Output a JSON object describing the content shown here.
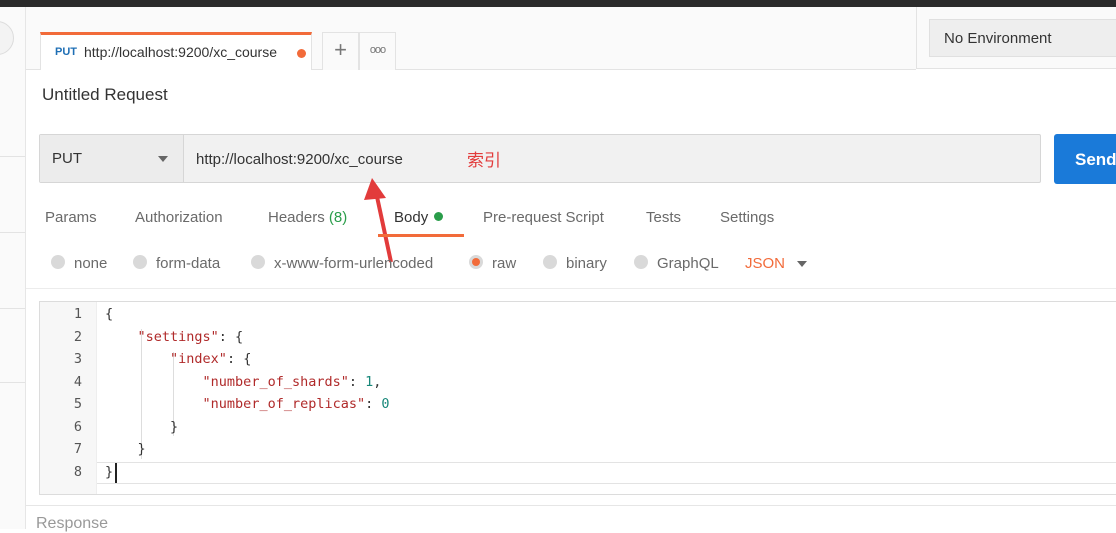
{
  "tab": {
    "method": "PUT",
    "url": "http://localhost:9200/xc_course"
  },
  "tab_actions": {
    "add": "+",
    "more": "ooo"
  },
  "environment": {
    "selected": "No Environment"
  },
  "request": {
    "name": "Untitled Request",
    "method": "PUT",
    "url": "http://localhost:9200/xc_course",
    "annotation": "索引",
    "send_label": "Send"
  },
  "request_tabs": [
    {
      "label": "Params"
    },
    {
      "label": "Authorization"
    },
    {
      "label": "Headers",
      "count": "(8)"
    },
    {
      "label": "Body"
    },
    {
      "label": "Pre-request Script"
    },
    {
      "label": "Tests"
    },
    {
      "label": "Settings"
    }
  ],
  "body_modes": [
    {
      "label": "none",
      "selected": false
    },
    {
      "label": "form-data",
      "selected": false
    },
    {
      "label": "x-www-form-urlencoded",
      "selected": false
    },
    {
      "label": "raw",
      "selected": true
    },
    {
      "label": "binary",
      "selected": false
    },
    {
      "label": "GraphQL",
      "selected": false
    }
  ],
  "raw_format": "JSON",
  "code_lines": [
    {
      "num": "1",
      "parts": [
        [
          "p",
          "{"
        ]
      ]
    },
    {
      "num": "2",
      "parts": [
        [
          "p",
          "    "
        ],
        [
          "k",
          "\"settings\""
        ],
        [
          "p",
          ": {"
        ]
      ]
    },
    {
      "num": "3",
      "parts": [
        [
          "p",
          "        "
        ],
        [
          "k",
          "\"index\""
        ],
        [
          "p",
          ": {"
        ]
      ]
    },
    {
      "num": "4",
      "parts": [
        [
          "p",
          "            "
        ],
        [
          "k",
          "\"number_of_shards\""
        ],
        [
          "p",
          ": "
        ],
        [
          "n",
          "1"
        ],
        [
          "p",
          ","
        ]
      ]
    },
    {
      "num": "5",
      "parts": [
        [
          "p",
          "            "
        ],
        [
          "k",
          "\"number_of_replicas\""
        ],
        [
          "p",
          ": "
        ],
        [
          "n",
          "0"
        ]
      ]
    },
    {
      "num": "6",
      "parts": [
        [
          "p",
          "        }"
        ]
      ]
    },
    {
      "num": "7",
      "parts": [
        [
          "p",
          "    }"
        ]
      ]
    },
    {
      "num": "8",
      "parts": [
        [
          "p",
          "}"
        ]
      ]
    }
  ],
  "response_label": "Response",
  "colors": {
    "accent": "#f26b3a",
    "send": "#1a7ad9",
    "annotation": "#e23b3b",
    "status_green": "#2a9d4a"
  }
}
